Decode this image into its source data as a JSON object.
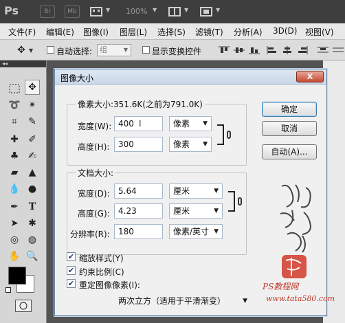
{
  "app": {
    "logo": "Ps",
    "bridge_label": "Br",
    "minibridge_label": "Mb",
    "zoom": "100%"
  },
  "menubar": {
    "items": [
      "文件(F)",
      "编辑(E)",
      "图像(I)",
      "图层(L)",
      "选择(S)",
      "滤镜(T)",
      "分析(A)",
      "3D(D)",
      "视图(V)"
    ]
  },
  "options": {
    "auto_select_label": "自动选择:",
    "auto_select_value": "组",
    "show_transform_label": "显示变换控件"
  },
  "dialog": {
    "title": "图像大小",
    "close_label": "X",
    "pixel_dimensions_label": "像素大小:351.6K(之前为791.0K)",
    "width_label": "宽度(W):",
    "width_value": "400",
    "width_unit": "像素",
    "height_label": "高度(H):",
    "height_value": "300",
    "height_unit": "像素",
    "document_size_label": "文档大小:",
    "doc_width_label": "宽度(D):",
    "doc_width_value": "5.64",
    "doc_width_unit": "厘米",
    "doc_height_label": "高度(G):",
    "doc_height_value": "4.23",
    "doc_height_unit": "厘米",
    "resolution_label": "分辨率(R):",
    "resolution_value": "180",
    "resolution_unit": "像素/英寸",
    "ok_label": "确定",
    "cancel_label": "取消",
    "auto_label": "自动(A)...",
    "scale_styles_label": "缩放样式(Y)",
    "constrain_label": "约束比例(C)",
    "resample_label": "重定图像像素(I):",
    "resample_method": "两次立方（适用于平滑渐变）",
    "checks": {
      "scale_styles": true,
      "constrain": true,
      "resample": true
    }
  },
  "watermark": {
    "text": "PS教程网",
    "url": "www.tata580.com"
  },
  "colors": {
    "foreground": "#000000",
    "background": "#ffffff"
  }
}
